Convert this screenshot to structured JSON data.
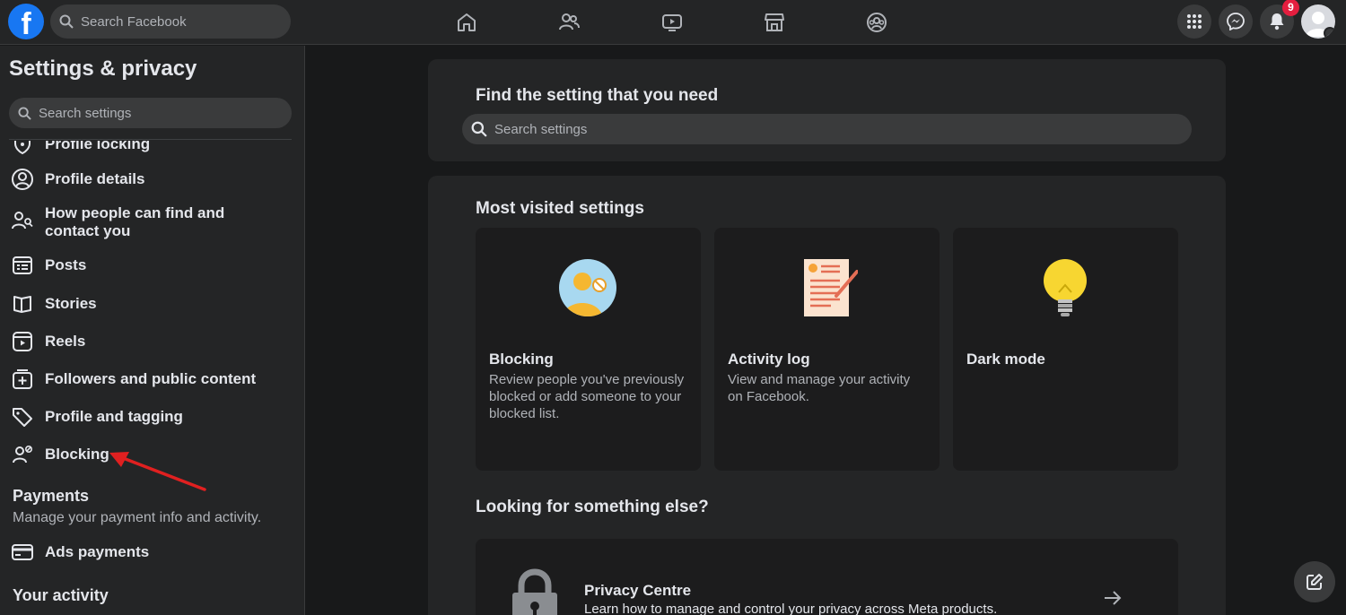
{
  "topbar": {
    "logo": "f",
    "search_placeholder": "Search Facebook",
    "nav_icons": [
      "home-icon",
      "friends-icon",
      "watch-icon",
      "marketplace-icon",
      "groups-icon"
    ],
    "right_icons": [
      "menu-grid-icon",
      "messenger-icon",
      "notifications-icon"
    ],
    "notification_count": "9"
  },
  "sidebar": {
    "title": "Settings & privacy",
    "search_placeholder": "Search settings",
    "items": [
      {
        "label": "Profile locking",
        "icon": "shield-icon"
      },
      {
        "label": "Profile details",
        "icon": "user-circle-icon"
      },
      {
        "label": "How people can find and contact you",
        "icon": "people-search-icon"
      },
      {
        "label": "Posts",
        "icon": "posts-icon"
      },
      {
        "label": "Stories",
        "icon": "stories-icon"
      },
      {
        "label": "Reels",
        "icon": "reels-icon"
      },
      {
        "label": "Followers and public content",
        "icon": "followers-icon"
      },
      {
        "label": "Profile and tagging",
        "icon": "tag-icon"
      },
      {
        "label": "Blocking",
        "icon": "block-user-icon"
      }
    ],
    "payments": {
      "heading": "Payments",
      "subtitle": "Manage your payment info and activity.",
      "item": "Ads payments"
    },
    "activity": {
      "heading": "Your activity"
    }
  },
  "main": {
    "find_title": "Find the setting that you need",
    "search_placeholder": "Search settings",
    "most_visited_title": "Most visited settings",
    "tiles": [
      {
        "title": "Blocking",
        "desc": "Review people you've previously blocked or add someone to your blocked list."
      },
      {
        "title": "Activity log",
        "desc": "View and manage your activity on Facebook."
      },
      {
        "title": "Dark mode",
        "desc": ""
      }
    ],
    "looking_title": "Looking for something else?",
    "privacy_centre": {
      "title": "Privacy Centre",
      "desc": "Learn how to manage and control your privacy across Meta products."
    }
  },
  "colors": {
    "background": "#18191a",
    "surface": "#242526",
    "accent": "#1877f2",
    "annotation_arrow": "#e02020"
  }
}
